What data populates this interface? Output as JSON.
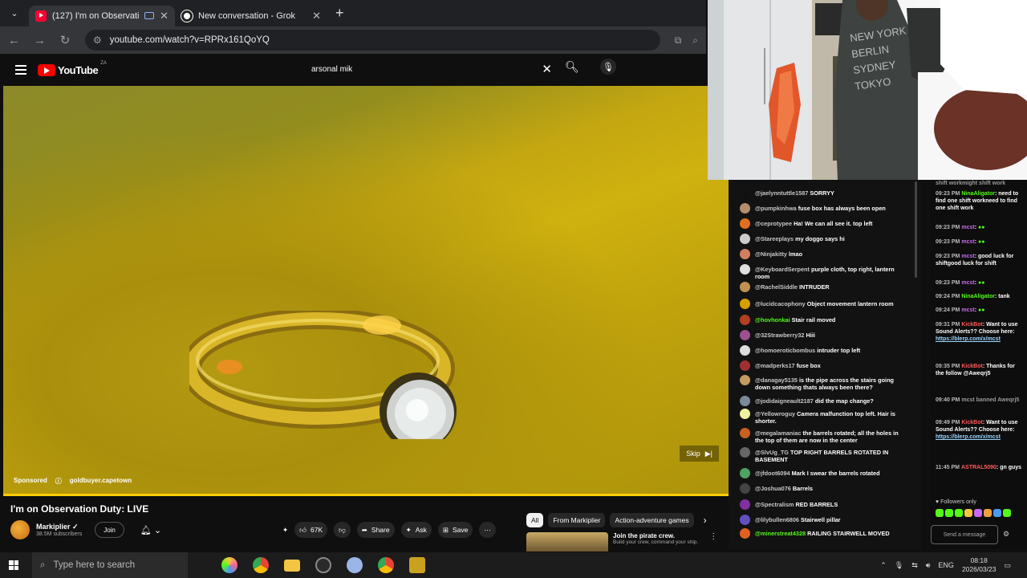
{
  "browser": {
    "tabs": [
      {
        "title": "(127) I'm on Observation D",
        "active": true
      },
      {
        "title": "New conversation - Grok",
        "active": false
      }
    ],
    "url": "youtube.com/watch?v=RPRx161QoYQ"
  },
  "youtube": {
    "logo_text": "YouTube",
    "region": "ZA",
    "search_query": "arsonal mik",
    "video": {
      "sponsored_label": "Sponsored",
      "sponsor_name": "goldbuyer.capetown",
      "skip_label": "Skip",
      "title": "I'm on Observation Duty: LIVE",
      "channel": "Markiplier",
      "subscribers": "38.5M subscribers",
      "join_label": "Join",
      "likes": "67K",
      "share_label": "Share",
      "ask_label": "Ask",
      "save_label": "Save"
    },
    "chips": [
      "All",
      "From Markiplier",
      "Action-adventure games"
    ],
    "recommended": {
      "title": "Join the pirate crew.",
      "description": "Build your crew, command your ship."
    }
  },
  "chat": [
    {
      "user": "@jaelynntuttle1587",
      "msg": "SORRYY",
      "avatar": "#111111"
    },
    {
      "user": "@pumpkinhwa",
      "msg": "fuse box has always been open",
      "avatar": "#b48c6e"
    },
    {
      "user": "@ceprotypee",
      "msg": "Ha! We can all see it. top left",
      "avatar": "#e07020"
    },
    {
      "user": "@Stareeplays",
      "msg": "my doggo says hi",
      "avatar": "#cccccc"
    },
    {
      "user": "@Ninjakitty",
      "msg": "lmao",
      "avatar": "#d08060"
    },
    {
      "user": "@KeyboardSerpent",
      "msg": "purple cloth, top right, lantern room",
      "avatar": "#e0e0e0"
    },
    {
      "user": "@RachelSiddle",
      "msg": "INTRUDER",
      "avatar": "#c09050"
    },
    {
      "user": "@lucidcacophony",
      "msg": "Object movement lantern room",
      "avatar": "#d4a000"
    },
    {
      "user": "@hovhonkai",
      "msg": "Stair rail moved",
      "avatar": "#b04020",
      "user_color": "#53fc18"
    },
    {
      "user": "@32Strawberry32",
      "msg": "Hiii",
      "avatar": "#9b5090"
    },
    {
      "user": "@homoeroticbombus",
      "msg": "intruder top left",
      "avatar": "#dddddd"
    },
    {
      "user": "@madperks17",
      "msg": "fuse box",
      "avatar": "#a03030"
    },
    {
      "user": "@danagay5135",
      "msg": "is the pipe across the stairs going down something thats always been there?",
      "avatar": "#c49a60"
    },
    {
      "user": "@jodidaigneault2187",
      "msg": "did the map change?",
      "avatar": "#7a8a9a"
    },
    {
      "user": "@Yellowroguy",
      "msg": "Camera malfunction top left. Hair is shorter.",
      "avatar": "#f0f0a0"
    },
    {
      "user": "@megalamaniac",
      "msg": "the barrels rotated; all the holes in the top of them are now in the center",
      "avatar": "#c86020"
    },
    {
      "user": "@SlvUg_TG",
      "msg": "TOP RIGHT BARRELS ROTATED IN BASEMENT",
      "avatar": "#666666"
    },
    {
      "user": "@jfdoot6094",
      "msg": "Mark I swear the barrels rotated",
      "avatar": "#50a060"
    },
    {
      "user": "@Joshua076",
      "msg": "Barrels",
      "avatar": "#444444"
    },
    {
      "user": "@Spectralism",
      "msg": "RED BARRELS",
      "avatar": "#8030a0"
    },
    {
      "user": "@lilybullen6806",
      "msg": "Stairwell pillar",
      "avatar": "#6050c0"
    },
    {
      "user": "@minerstreat4328",
      "msg": "RAILING STAIRWELL MOVED",
      "avatar": "#e06020",
      "user_color": "#53fc18"
    }
  ],
  "side_chat": [
    {
      "time": "",
      "user": "",
      "msg": "shift workmight shift work",
      "cls": "dim"
    },
    {
      "time": "09:23 PM",
      "user": "NinaAligator",
      "msg": "need to find one shift workneed to find one shift work",
      "ucls": "g"
    },
    {
      "time": "09:23 PM",
      "user": "mcst",
      "msg": "",
      "ucls": "v"
    },
    {
      "time": "09:23 PM",
      "user": "mcst",
      "msg": "",
      "ucls": "v"
    },
    {
      "time": "09:23 PM",
      "user": "mcst",
      "msg": "good luck for shiftgood luck for shift",
      "ucls": "v"
    },
    {
      "time": "09:23 PM",
      "user": "mcst",
      "msg": "",
      "ucls": "v"
    },
    {
      "time": "09:24 PM",
      "user": "NinaAligator",
      "msg": "tank",
      "ucls": "g"
    },
    {
      "time": "09:24 PM",
      "user": "mcst",
      "msg": "",
      "ucls": "v"
    },
    {
      "time": "09:31 PM",
      "user": "KickBot",
      "msg": "Want to use Sound Alerts?? Choose here:",
      "ucls": "r",
      "link": "https://blerp.com/x/mcst"
    },
    {
      "time": "09:35 PM",
      "user": "KickBot",
      "msg": "Thanks for the follow @Aweqrj5",
      "ucls": "r"
    },
    {
      "time": "09:40 PM",
      "user": "",
      "msg": "mcst banned Aweqrj5",
      "cls": "dim"
    },
    {
      "time": "09:49 PM",
      "user": "KickBot",
      "msg": "Want to use Sound Alerts?? Choose here:",
      "ucls": "r",
      "link": "https://blerp.com/x/mcst"
    },
    {
      "time": "11:45 PM",
      "user": "ASTRAL5090",
      "msg": "gn guys",
      "ucls": "r"
    }
  ],
  "side_footer": {
    "followers_only": "Followers only",
    "send": "Send a message"
  },
  "taskbar": {
    "search_placeholder": "Type here to search",
    "language": "ENG",
    "time": "08:18",
    "date": "2026/03/23"
  },
  "colors": {
    "accent_green": "#53fc18",
    "yt_red": "#ff0000"
  }
}
